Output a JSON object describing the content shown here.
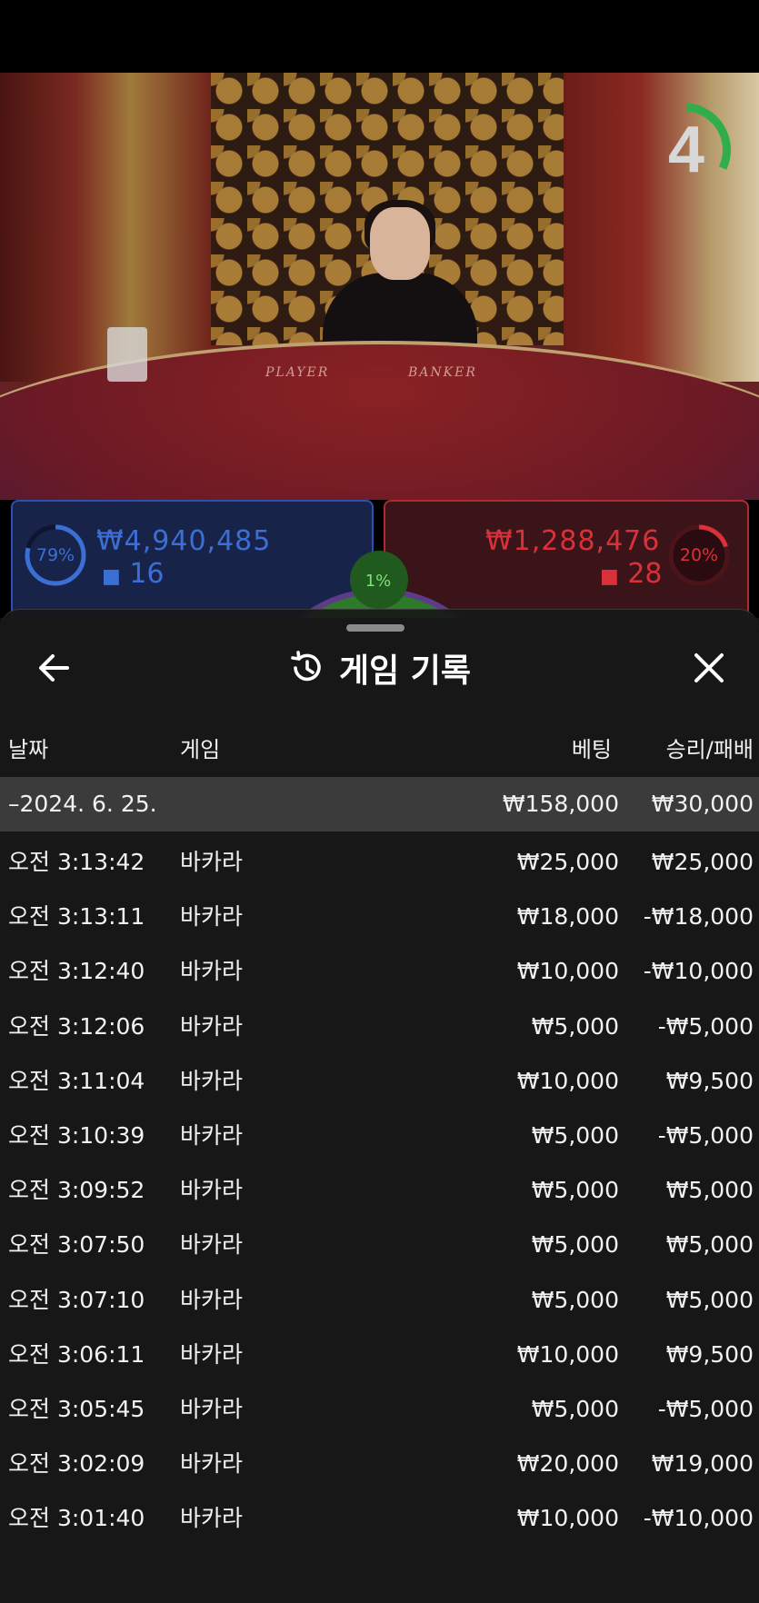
{
  "stream": {
    "timer_value": "4",
    "table_labels": {
      "player": "PLAYER",
      "banker": "BANKER"
    }
  },
  "bets": {
    "player": {
      "percent": "79%",
      "percent_value": 0.79,
      "amount": "₩4,940,485",
      "players": "16",
      "color": "#3b6fd6"
    },
    "banker": {
      "percent": "20%",
      "percent_value": 0.2,
      "amount": "₩1,288,476",
      "players": "28",
      "color": "#d8313a"
    },
    "tie": {
      "percent": "1%",
      "percent_value": 0.01,
      "color": "#3fa83a"
    }
  },
  "panel": {
    "title": "게임 기록",
    "icons": {
      "back": "arrow-left-icon",
      "history": "history-clock-icon",
      "close": "close-icon"
    },
    "columns": {
      "date": "날짜",
      "game": "게임",
      "bet": "베팅",
      "result": "승리/패배"
    },
    "date_group": {
      "date": "–2024. 6. 25.",
      "total_bet": "₩158,000",
      "total_result": "₩30,000"
    },
    "rows": [
      {
        "time": "오전 3:13:42",
        "game": "바카라",
        "bet": "₩25,000",
        "result": "₩25,000"
      },
      {
        "time": "오전 3:13:11",
        "game": "바카라",
        "bet": "₩18,000",
        "result": "-₩18,000"
      },
      {
        "time": "오전 3:12:40",
        "game": "바카라",
        "bet": "₩10,000",
        "result": "-₩10,000"
      },
      {
        "time": "오전 3:12:06",
        "game": "바카라",
        "bet": "₩5,000",
        "result": "-₩5,000"
      },
      {
        "time": "오전 3:11:04",
        "game": "바카라",
        "bet": "₩10,000",
        "result": "₩9,500"
      },
      {
        "time": "오전 3:10:39",
        "game": "바카라",
        "bet": "₩5,000",
        "result": "-₩5,000"
      },
      {
        "time": "오전 3:09:52",
        "game": "바카라",
        "bet": "₩5,000",
        "result": "₩5,000"
      },
      {
        "time": "오전 3:07:50",
        "game": "바카라",
        "bet": "₩5,000",
        "result": "₩5,000"
      },
      {
        "time": "오전 3:07:10",
        "game": "바카라",
        "bet": "₩5,000",
        "result": "₩5,000"
      },
      {
        "time": "오전 3:06:11",
        "game": "바카라",
        "bet": "₩10,000",
        "result": "₩9,500"
      },
      {
        "time": "오전 3:05:45",
        "game": "바카라",
        "bet": "₩5,000",
        "result": "-₩5,000"
      },
      {
        "time": "오전 3:02:09",
        "game": "바카라",
        "bet": "₩20,000",
        "result": "₩19,000"
      },
      {
        "time": "오전 3:01:40",
        "game": "바카라",
        "bet": "₩10,000",
        "result": "-₩10,000"
      }
    ]
  }
}
